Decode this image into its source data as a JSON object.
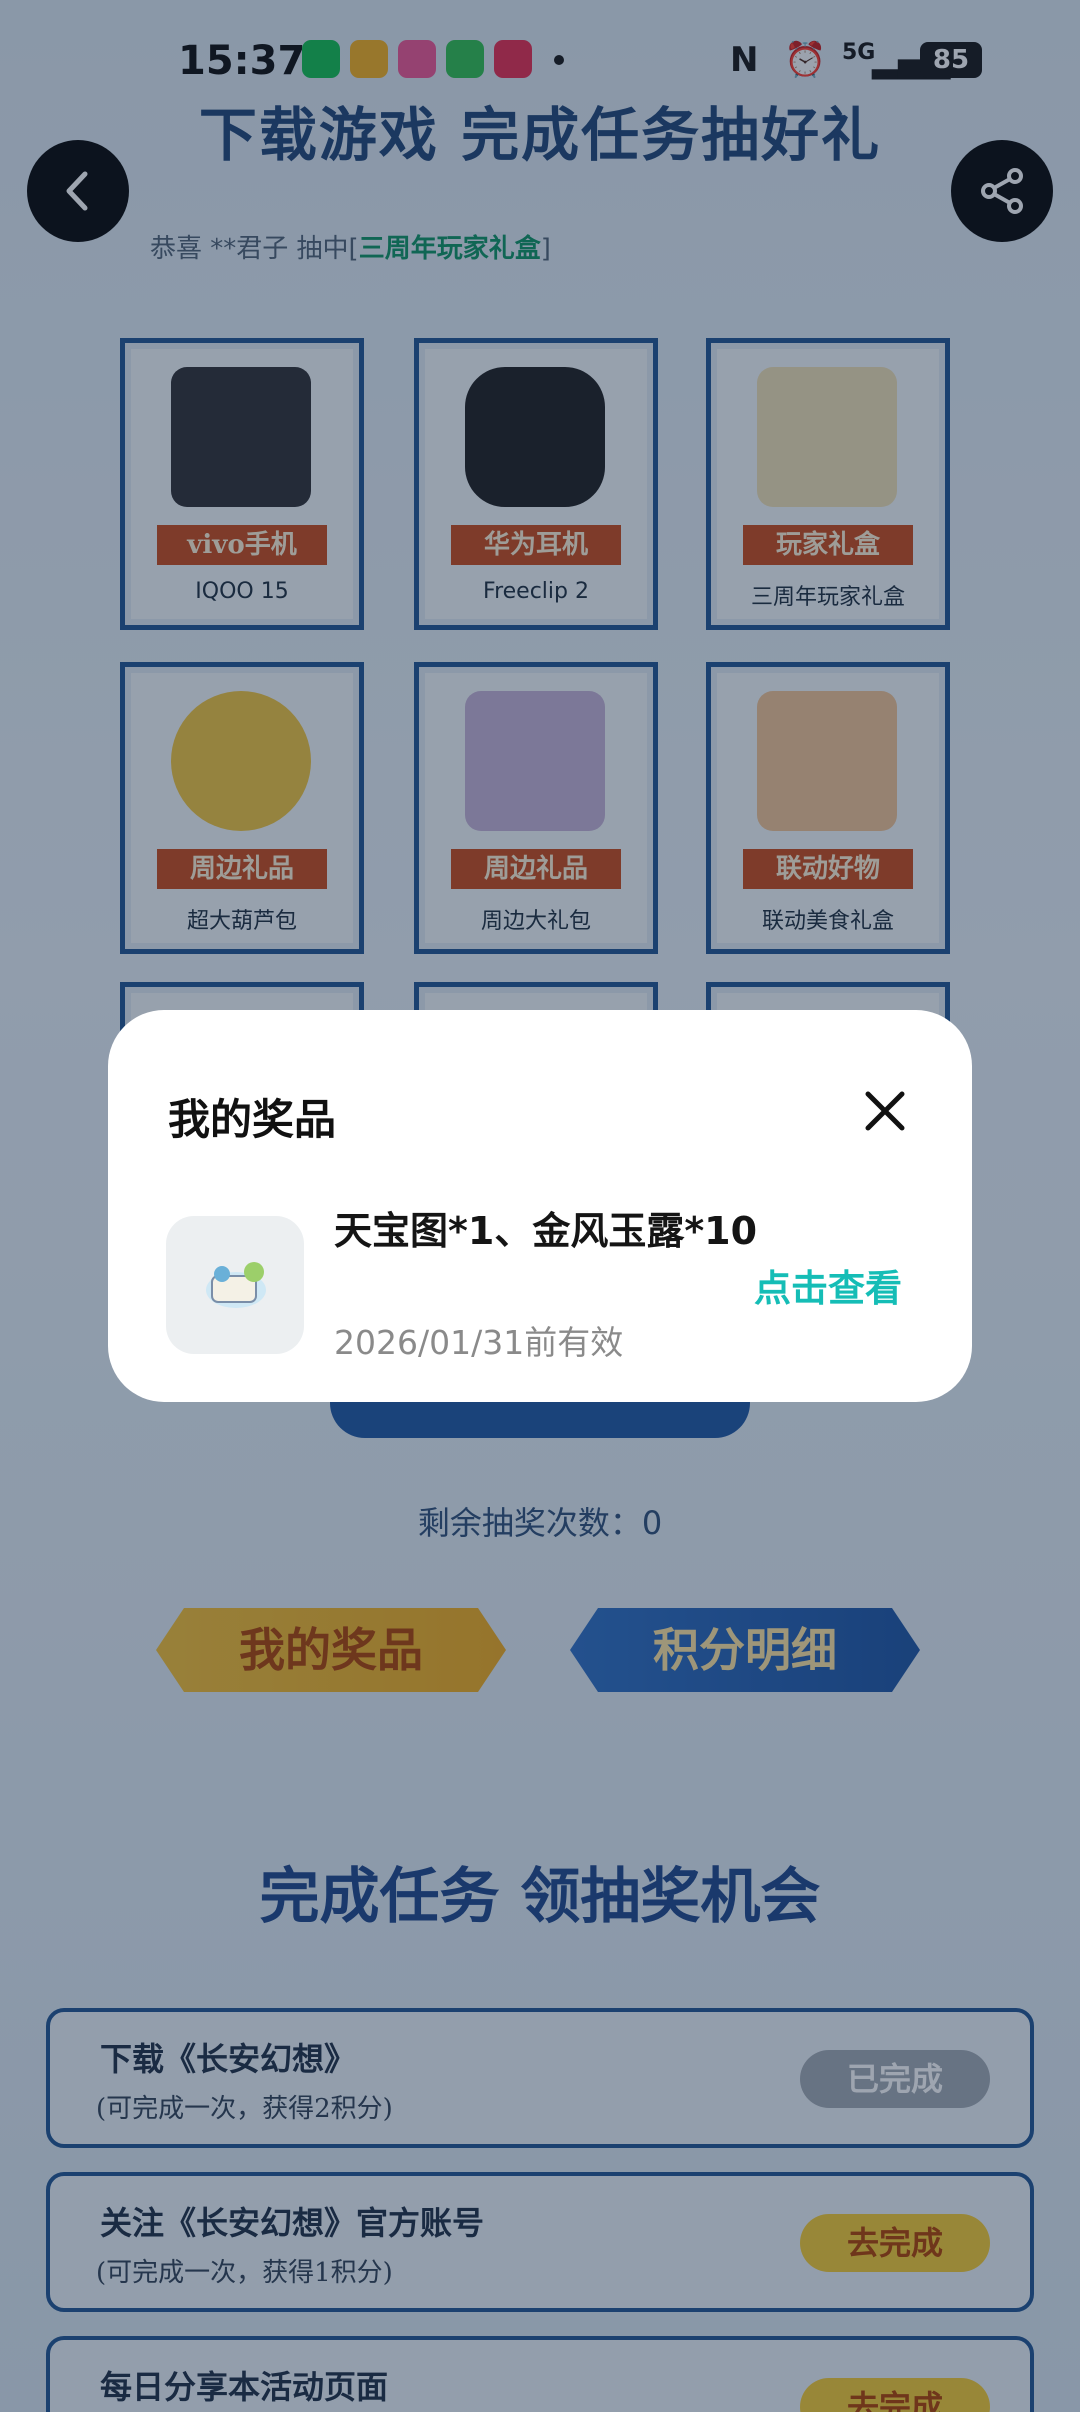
{
  "status_bar": {
    "time": "15:37",
    "network": "5G",
    "battery": "85",
    "icons": [
      "wechat-icon",
      "weibo-icon",
      "bilibili-icon",
      "messages-icon",
      "game-center-icon",
      "nfc-icon",
      "alarm-icon",
      "signal-icon"
    ]
  },
  "page": {
    "banner_title": "下载游戏 完成任务抽好礼",
    "ticker": {
      "prefix": "恭喜 **君子 抽中[",
      "highlight": "三周年玩家礼盒",
      "suffix": "]"
    },
    "prizes": [
      {
        "tag": "vivo手机",
        "name": "IQOO 15"
      },
      {
        "tag": "华为耳机",
        "name": "Freeclip 2"
      },
      {
        "tag": "玩家礼盒",
        "name": "三周年玩家礼盒"
      },
      {
        "tag": "周边礼品",
        "name": "超大葫芦包"
      },
      {
        "tag": "周边礼品",
        "name": "周边大礼包"
      },
      {
        "tag": "联动好物",
        "name": "联动美食礼盒"
      }
    ],
    "remaining_draws": "剩余抽奖次数：0",
    "tab_my_prizes": "我的奖品",
    "tab_points_detail": "积分明细",
    "task_section_title": "完成任务 领抽奖机会",
    "tasks": [
      {
        "name": "下载《长安幻想》",
        "desc": "(可完成一次，获得2积分)",
        "button": "已完成",
        "state": "done"
      },
      {
        "name": "关注《长安幻想》官方账号",
        "desc": "(可完成一次，获得1积分)",
        "button": "去完成",
        "state": "todo"
      },
      {
        "name": "每日分享本活动页面",
        "desc": "",
        "button": "去完成",
        "state": "todo"
      }
    ]
  },
  "modal": {
    "title": "我的奖品",
    "prize_name": "天宝图*1、金风玉露*10",
    "valid_until": "2026/01/31前有效",
    "view_button": "点击查看",
    "accent_color": "#15bdb6"
  }
}
